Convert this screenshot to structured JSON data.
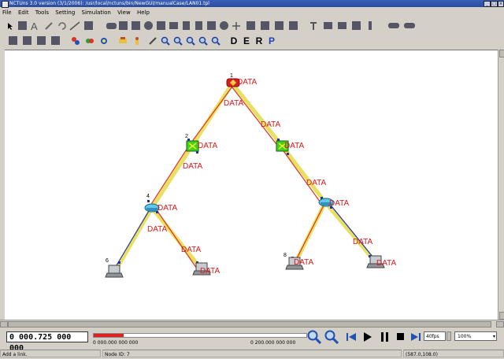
{
  "window": {
    "title": "NCTUns 3.0 version (3/1/2006): /usr/local/nctuns/bin/NewGUI/manualCase/LAN01.tpl",
    "buttons": [
      "_",
      "□",
      "×"
    ]
  },
  "menu": {
    "items": [
      "File",
      "Edit",
      "Tools",
      "Setting",
      "Simulation",
      "View",
      "Help"
    ]
  },
  "toolbar2": {
    "mode_labels": [
      "D",
      "E",
      "R",
      "P"
    ]
  },
  "topology": {
    "nodes": [
      {
        "id": "1",
        "kind": "router",
        "label": "1"
      },
      {
        "id": "2",
        "kind": "switch",
        "label": "2"
      },
      {
        "id": "3",
        "kind": "switch",
        "label": ""
      },
      {
        "id": "4",
        "kind": "hub",
        "label": "4"
      },
      {
        "id": "5",
        "kind": "hub",
        "label": ""
      },
      {
        "id": "6",
        "kind": "host",
        "label": "6"
      },
      {
        "id": "7",
        "kind": "host",
        "label": ""
      },
      {
        "id": "8",
        "kind": "host",
        "label": "8"
      },
      {
        "id": "9",
        "kind": "host",
        "label": ""
      }
    ],
    "packet_label": "DATA"
  },
  "playback": {
    "time_display": "0 000.725 000 000",
    "progress": 0.14,
    "start_time": "0 000.000 000 000",
    "end_time": "0 200.000 000 000",
    "speed": "40fps",
    "zoom": "100%"
  },
  "status": {
    "message": "Add a link.",
    "node_id": "Node ID: 7",
    "coords": "(587.0,108.0)"
  },
  "colors": {
    "link_yellow": "#e8e060",
    "link_red": "#e03020",
    "link_blue": "#2030b0",
    "packet_text": "#d81818",
    "titlebar": "#2b4c9e"
  }
}
